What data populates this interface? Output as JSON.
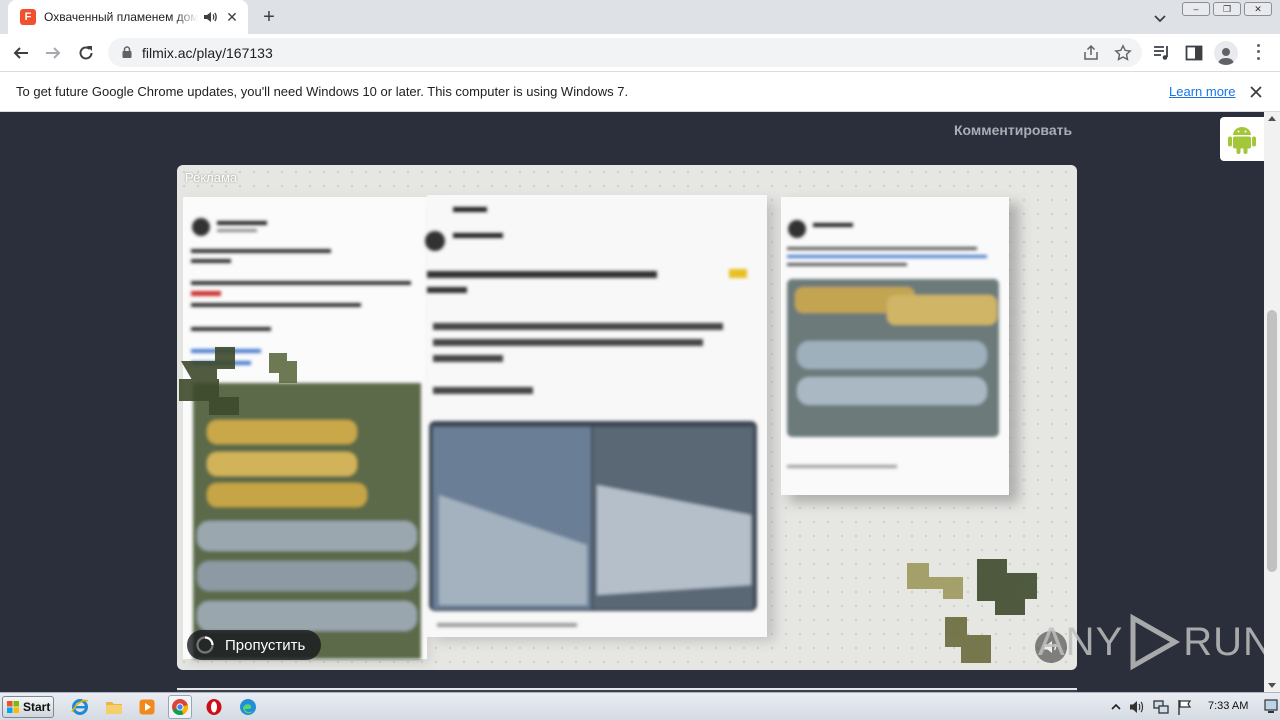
{
  "browser": {
    "tab": {
      "favicon_letter": "F",
      "title": "Охваченный пламенем дом Ма",
      "close_glyph": "✕"
    },
    "new_tab_glyph": "+",
    "window_controls": [
      "–",
      "❐",
      "✕"
    ],
    "url": "filmix.ac/play/167133"
  },
  "infobar": {
    "message": "To get future Google Chrome updates, you'll need Windows 10 or later. This computer is using Windows 7.",
    "learn_more": "Learn more"
  },
  "page": {
    "comment_link": "Комментировать",
    "player": {
      "ad_label": "Реклама",
      "skip_label": "Пропустить"
    }
  },
  "watermark": {
    "left": "ANY",
    "right": "RUN"
  },
  "taskbar": {
    "start_label": "Start",
    "clock": "7:33 AM",
    "apps": [
      "internet-explorer",
      "file-explorer",
      "media-player",
      "chrome",
      "opera",
      "edge"
    ]
  },
  "colors": {
    "page_bg": "#2b2f3b",
    "favicon": "#f0502e",
    "link_blue": "#1a73e8",
    "android_green": "#a4c639"
  }
}
